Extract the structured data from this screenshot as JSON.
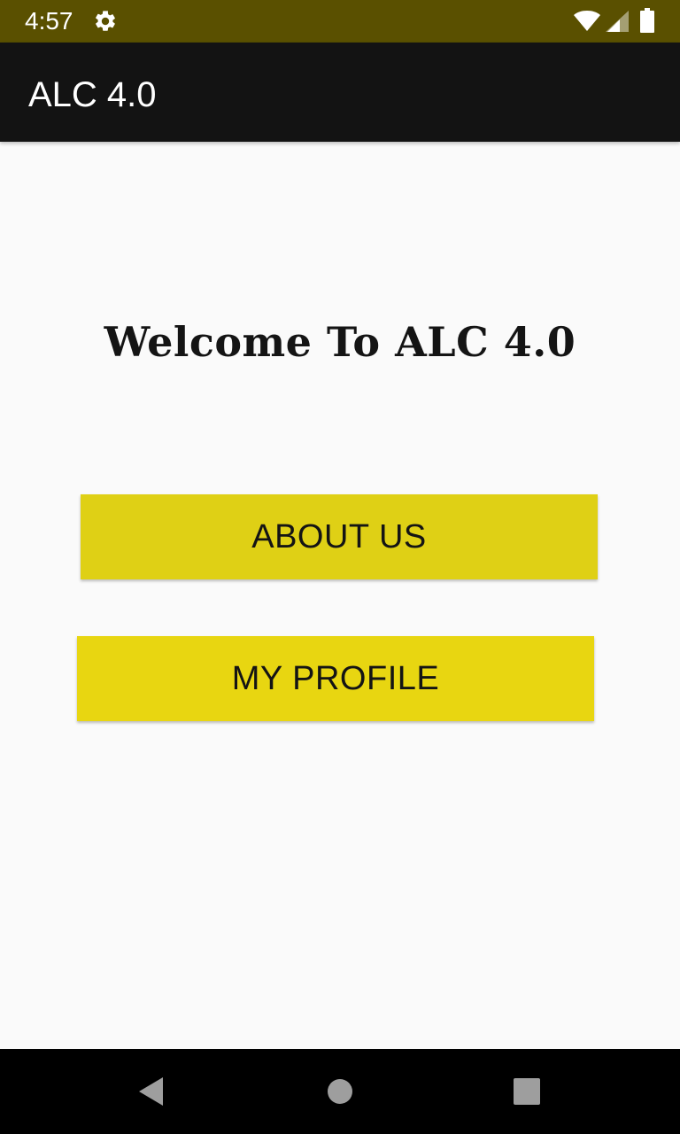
{
  "status_bar": {
    "time": "4:57",
    "background": "#5a5000",
    "icons": [
      "gear-icon",
      "wifi-icon",
      "signal-icon",
      "battery-icon"
    ]
  },
  "app_bar": {
    "title": "ALC 4.0",
    "background": "#131313"
  },
  "main": {
    "welcome": "Welcome To ALC 4.0",
    "buttons": [
      {
        "label": "ABOUT US",
        "color": "#dfd015"
      },
      {
        "label": "MY PROFILE",
        "color": "#e8d611"
      }
    ]
  },
  "nav_bar": {
    "icons": [
      "back-icon",
      "home-icon",
      "recents-icon"
    ]
  }
}
